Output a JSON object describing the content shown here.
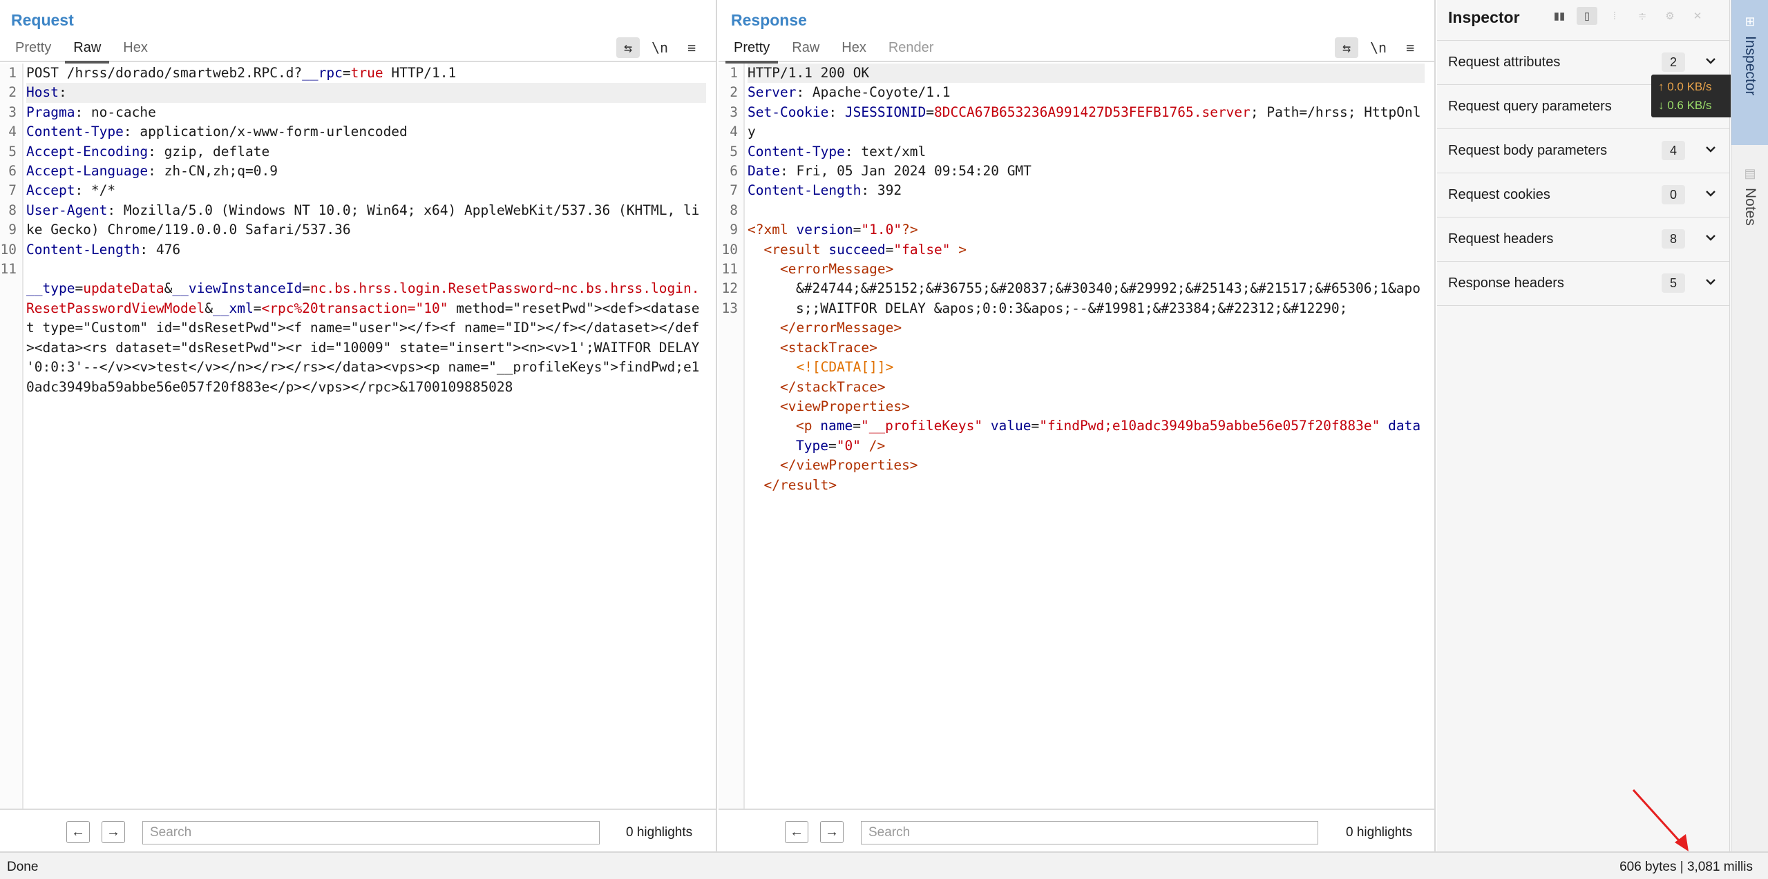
{
  "request": {
    "title": "Request",
    "tabs": [
      "Pretty",
      "Raw",
      "Hex"
    ],
    "active_tab": "Raw",
    "tools": {
      "wrap": "⇆",
      "newline": "\\n",
      "menu": "≡"
    },
    "line_numbers": [
      "1",
      "2",
      "3",
      "4",
      "5",
      "6",
      "7",
      "8",
      "",
      "9",
      "10",
      "11",
      "",
      "",
      "",
      "",
      "",
      "",
      "",
      ""
    ],
    "search_placeholder": "Search",
    "highlights": "0 highlights"
  },
  "response": {
    "title": "Response",
    "tabs": [
      "Pretty",
      "Raw",
      "Hex",
      "Render"
    ],
    "active_tab": "Pretty",
    "tools": {
      "wrap": "⇆",
      "newline": "\\n",
      "menu": "≡"
    },
    "line_numbers": [
      "1",
      "2",
      "3",
      "",
      "4",
      "5",
      "6",
      "7",
      "8",
      "9",
      "10",
      "",
      "",
      "11",
      "",
      "",
      "12",
      "",
      "",
      "13"
    ],
    "search_placeholder": "Search",
    "highlights": "0 highlights"
  },
  "inspector": {
    "title": "Inspector",
    "sections": [
      {
        "label": "Request attributes",
        "count": "2"
      },
      {
        "label": "Request query parameters",
        "count": ""
      },
      {
        "label": "Request body parameters",
        "count": "4"
      },
      {
        "label": "Request cookies",
        "count": "0"
      },
      {
        "label": "Request headers",
        "count": "8"
      },
      {
        "label": "Response headers",
        "count": "5"
      }
    ]
  },
  "speed": {
    "up": "↑ 0.0 KB/s",
    "down": "↓ 0.6 KB/s"
  },
  "side_tabs": {
    "inspector": "Inspector",
    "notes": "Notes"
  },
  "status": {
    "left": "Done",
    "right": "606 bytes | 3,081 millis"
  },
  "colors": {
    "title_blue": "#3d85c6",
    "header_key": "#00008b",
    "value_red": "#c4000b",
    "side_active": "#b8cde6"
  }
}
